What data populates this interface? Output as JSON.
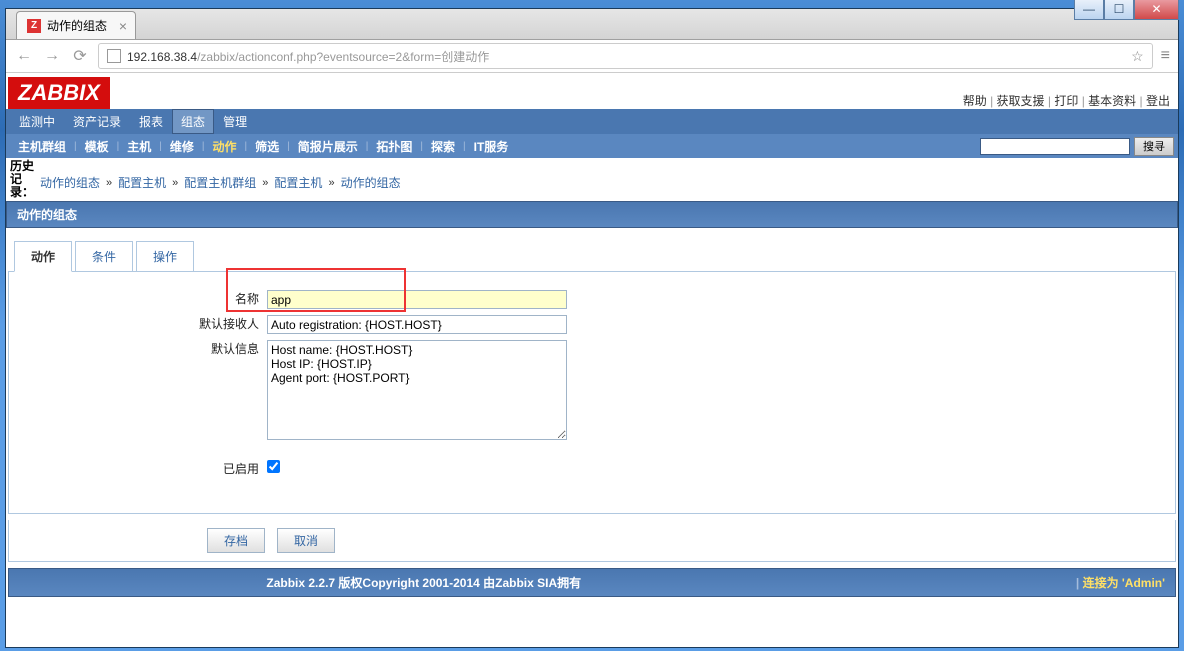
{
  "window": {
    "tab_title": "动作的组态"
  },
  "addr": {
    "url_main": "192.168.38.4",
    "url_rest": "/zabbix/actionconf.php?eventsource=2&form=创建动作"
  },
  "top_links": [
    "帮助",
    "获取支援",
    "打印",
    "基本资料",
    "登出"
  ],
  "menu_main": [
    "监测中",
    "资产记录",
    "报表",
    "组态",
    "管理"
  ],
  "menu_sub": [
    "主机群组",
    "模板",
    "主机",
    "维修",
    "动作",
    "筛选",
    "简报片展示",
    "拓扑图",
    "探索",
    "IT服务"
  ],
  "search_button": "搜寻",
  "history": {
    "label": "历史记录：",
    "items": [
      "动作的组态",
      "配置主机",
      "配置主机群组",
      "配置主机",
      "动作的组态"
    ]
  },
  "section_title": "动作的组态",
  "form_tabs": [
    "动作",
    "条件",
    "操作"
  ],
  "form": {
    "name_label": "名称",
    "name_value": "app",
    "recipient_label": "默认接收人",
    "recipient_value": "Auto registration: {HOST.HOST}",
    "message_label": "默认信息",
    "message_value": "Host name: {HOST.HOST}\nHost IP: {HOST.IP}\nAgent port: {HOST.PORT}",
    "enabled_label": "已启用"
  },
  "buttons": {
    "save": "存档",
    "cancel": "取消"
  },
  "footer": {
    "copyright": "Zabbix 2.2.7  版权Copyright 2001-2014 由Zabbix SIA拥有",
    "connected": "连接为 'Admin'"
  }
}
